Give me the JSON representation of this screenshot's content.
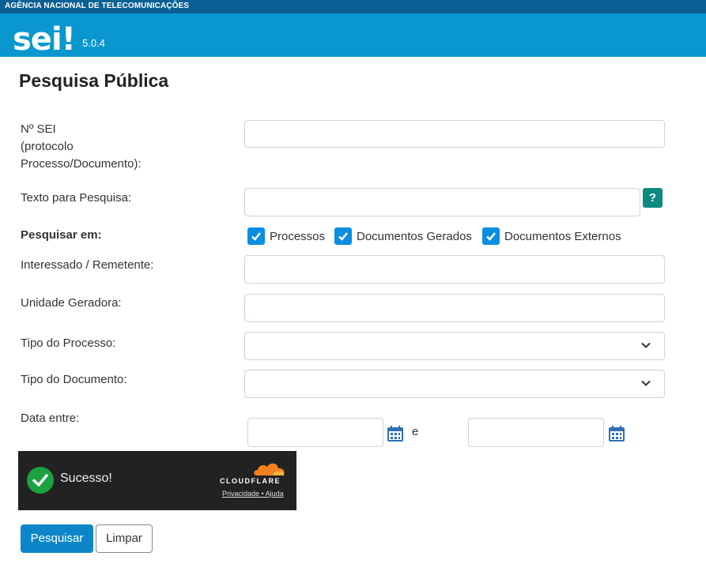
{
  "header": {
    "agency": "AGÊNCIA NACIONAL DE TELECOMUNICAÇÕES",
    "logo": "sei!",
    "version": "5.0.4"
  },
  "page": {
    "title": "Pesquisa Pública"
  },
  "form": {
    "nsei_label": "Nº SEI\n(protocolo\nProcesso/Documento):",
    "nsei_value": "",
    "texto_label": "Texto para Pesquisa:",
    "texto_value": "",
    "help_label": "?",
    "pesquisar_em_label": "Pesquisar em:",
    "checkboxes": [
      {
        "label": "Processos",
        "checked": true
      },
      {
        "label": "Documentos Gerados",
        "checked": true
      },
      {
        "label": "Documentos Externos",
        "checked": true
      }
    ],
    "interessado_label": "Interessado / Remetente:",
    "interessado_value": "",
    "unidade_label": "Unidade Geradora:",
    "unidade_value": "",
    "tipo_processo_label": "Tipo do Processo:",
    "tipo_processo_value": "",
    "tipo_documento_label": "Tipo do Documento:",
    "tipo_documento_value": "",
    "data_label": "Data entre:",
    "data_start": "",
    "data_sep": "e",
    "data_end": ""
  },
  "captcha": {
    "status": "Sucesso!",
    "brand": "CLOUDFLARE",
    "links": "Privacidade • Ajuda"
  },
  "buttons": {
    "search": "Pesquisar",
    "clear": "Limpar"
  },
  "colors": {
    "header_top": "#0b5f95",
    "header": "#0a97cf",
    "primary": "#0d86c9",
    "help": "#0c8a80",
    "checkbox": "#0a8ee0",
    "success": "#1aa340"
  }
}
